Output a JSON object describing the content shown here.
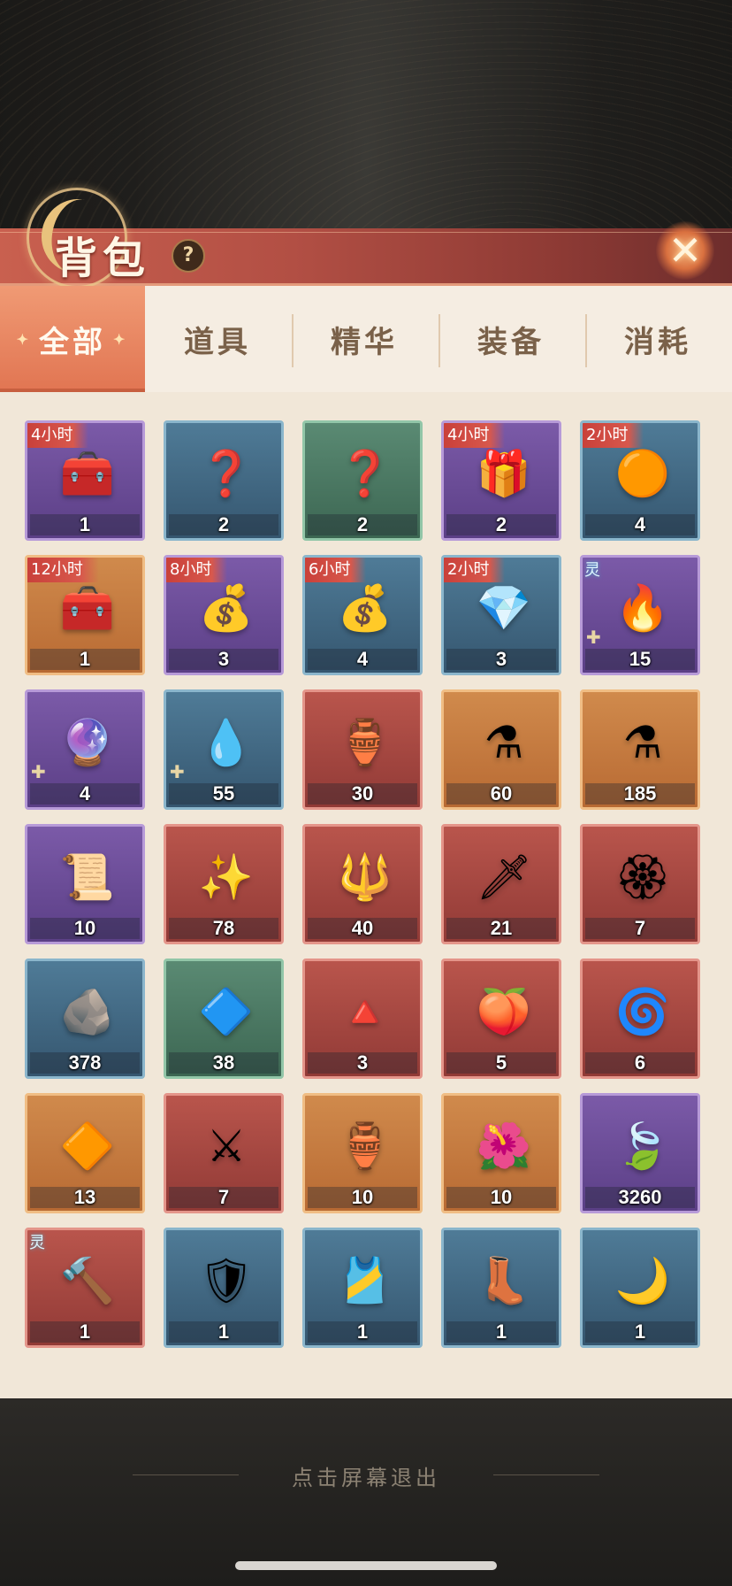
{
  "header": {
    "title": "背包",
    "help_icon": "?",
    "close_icon": "✕"
  },
  "tabs": [
    {
      "label": "全部",
      "active": true
    },
    {
      "label": "道具",
      "active": false
    },
    {
      "label": "精华",
      "active": false
    },
    {
      "label": "装备",
      "active": false
    },
    {
      "label": "消耗",
      "active": false
    }
  ],
  "items": [
    {
      "tag": "4小时",
      "count": "1",
      "quality": "purple",
      "icon": "treasure-chest-orbs-icon",
      "glyph": "🧰"
    },
    {
      "tag": "",
      "count": "2",
      "quality": "blue",
      "icon": "mystery-chest-icon",
      "glyph": "❓"
    },
    {
      "tag": "",
      "count": "2",
      "quality": "green",
      "icon": "mystery-chest-icon",
      "glyph": "❓"
    },
    {
      "tag": "4小时",
      "count": "2",
      "quality": "purple",
      "icon": "orb-box-icon",
      "glyph": "🎁"
    },
    {
      "tag": "2小时",
      "count": "4",
      "quality": "blue",
      "icon": "orb-pile-icon",
      "glyph": "🟠"
    },
    {
      "tag": "12小时",
      "count": "1",
      "quality": "orange",
      "icon": "jade-chest-icon",
      "glyph": "🧰"
    },
    {
      "tag": "8小时",
      "count": "3",
      "quality": "purple",
      "icon": "jade-sacks-icon",
      "glyph": "💰"
    },
    {
      "tag": "6小时",
      "count": "4",
      "quality": "blue",
      "icon": "jade-sack-icon",
      "glyph": "💰"
    },
    {
      "tag": "2小时",
      "count": "3",
      "quality": "blue",
      "icon": "jade-pile-icon",
      "glyph": "💎"
    },
    {
      "tag": "",
      "spirit": "灵",
      "count": "15",
      "quality": "purple",
      "icon": "green-spirit-flame-icon",
      "glyph": "🔥",
      "piece": true
    },
    {
      "tag": "",
      "count": "4",
      "quality": "purple",
      "icon": "purple-flame-icon",
      "glyph": "🔮",
      "piece": true
    },
    {
      "tag": "",
      "count": "55",
      "quality": "blue",
      "icon": "blue-flame-icon",
      "glyph": "💧",
      "piece": true
    },
    {
      "tag": "",
      "count": "30",
      "quality": "red",
      "icon": "green-gourd-icon",
      "glyph": "🏺"
    },
    {
      "tag": "",
      "count": "60",
      "quality": "orange",
      "icon": "red-potion-icon",
      "glyph": "⚗"
    },
    {
      "tag": "",
      "count": "185",
      "quality": "orange",
      "icon": "green-potion-icon",
      "glyph": "⚗"
    },
    {
      "tag": "",
      "count": "10",
      "quality": "purple",
      "icon": "scroll-icon",
      "glyph": "📜"
    },
    {
      "tag": "",
      "count": "78",
      "quality": "red",
      "icon": "golden-staff-icon",
      "glyph": "✨"
    },
    {
      "tag": "",
      "count": "40",
      "quality": "red",
      "icon": "golden-spear-icon",
      "glyph": "🔱"
    },
    {
      "tag": "",
      "count": "21",
      "quality": "red",
      "icon": "dark-spear-icon",
      "glyph": "🗡"
    },
    {
      "tag": "",
      "count": "7",
      "quality": "red",
      "icon": "lotus-talisman-icon",
      "glyph": "🏵"
    },
    {
      "tag": "",
      "count": "378",
      "quality": "blue",
      "icon": "ore-stone-icon",
      "glyph": "🪨"
    },
    {
      "tag": "",
      "count": "38",
      "quality": "green",
      "icon": "dark-stone-icon",
      "glyph": "🔷"
    },
    {
      "tag": "",
      "count": "3",
      "quality": "red",
      "icon": "salt-tray-icon",
      "glyph": "🔺"
    },
    {
      "tag": "",
      "count": "5",
      "quality": "red",
      "icon": "flame-pearl-icon",
      "glyph": "🍑"
    },
    {
      "tag": "",
      "count": "6",
      "quality": "red",
      "icon": "phoenix-feather-icon",
      "glyph": "🌀"
    },
    {
      "tag": "",
      "count": "13",
      "quality": "orange",
      "icon": "gold-crystal-icon",
      "glyph": "🔶"
    },
    {
      "tag": "",
      "count": "7",
      "quality": "red",
      "icon": "sword-banner-icon",
      "glyph": "⚔"
    },
    {
      "tag": "",
      "count": "10",
      "quality": "orange",
      "icon": "jade-vase-icon",
      "glyph": "🏺"
    },
    {
      "tag": "",
      "count": "10",
      "quality": "orange",
      "icon": "red-flower-icon",
      "glyph": "🌺"
    },
    {
      "tag": "",
      "count": "3260",
      "quality": "purple",
      "icon": "crystal-powder-leaf-icon",
      "glyph": "🍃"
    },
    {
      "tag": "",
      "spirit": "灵",
      "count": "1",
      "quality": "red",
      "icon": "war-hammer-icon",
      "glyph": "🔨"
    },
    {
      "tag": "",
      "count": "1",
      "quality": "blue",
      "icon": "armor-chest-icon",
      "glyph": "🛡"
    },
    {
      "tag": "",
      "count": "1",
      "quality": "blue",
      "icon": "armor-belt-icon",
      "glyph": "🎽"
    },
    {
      "tag": "",
      "count": "1",
      "quality": "blue",
      "icon": "armor-boots-icon",
      "glyph": "👢"
    },
    {
      "tag": "",
      "count": "1",
      "quality": "blue",
      "icon": "crescent-blade-icon",
      "glyph": "🌙"
    }
  ],
  "footer": {
    "exit_hint": "点击屏幕退出"
  }
}
